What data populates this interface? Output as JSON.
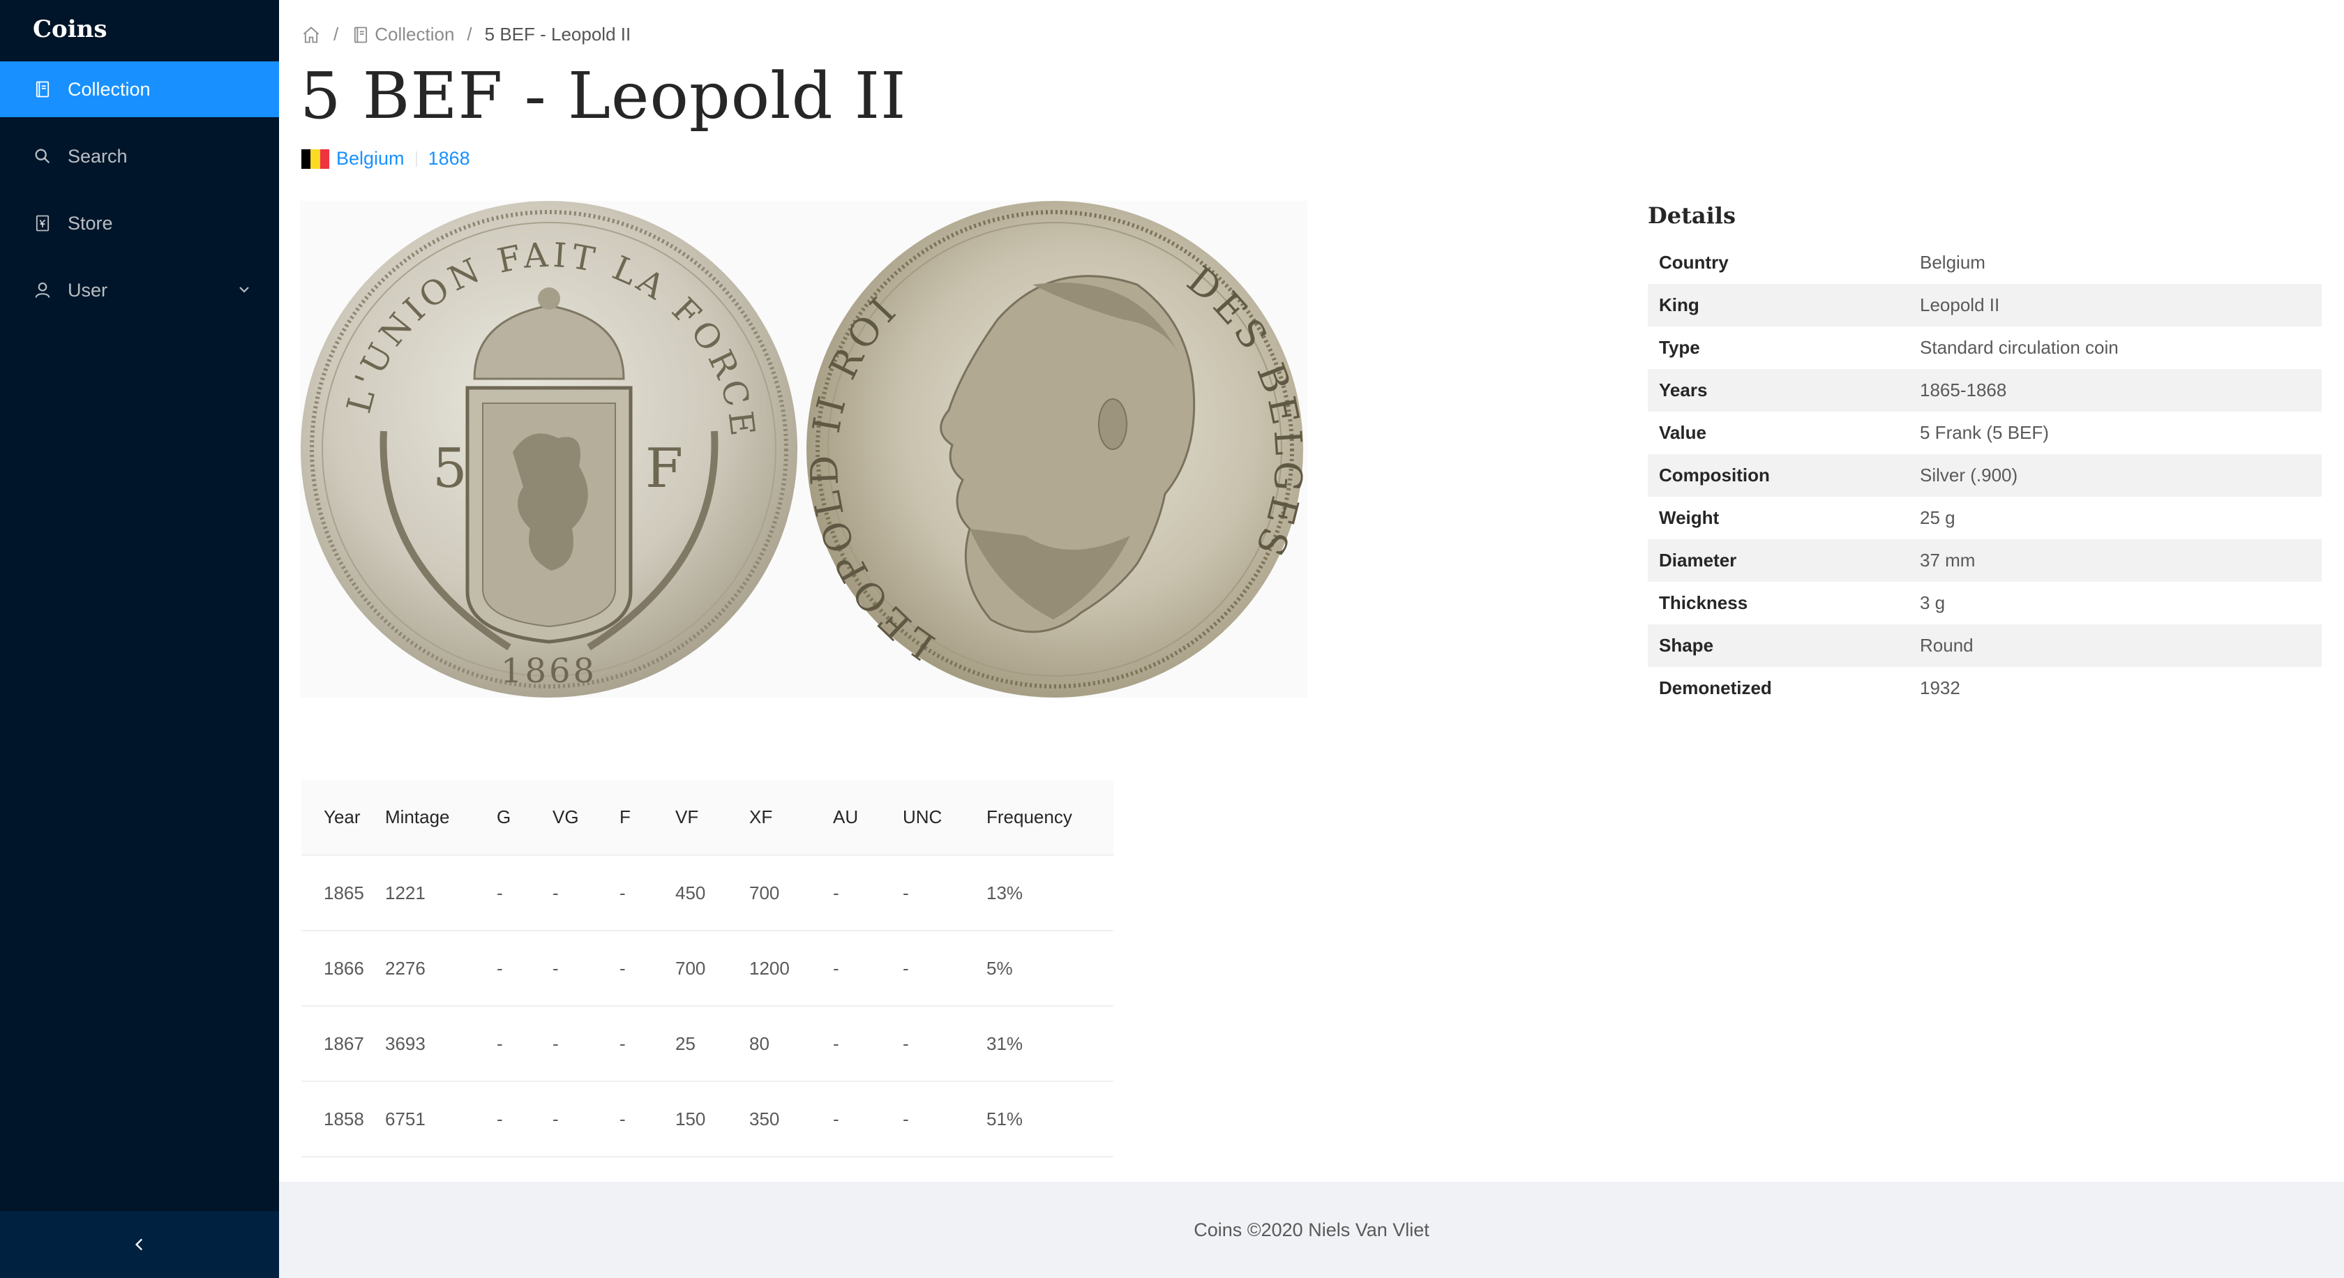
{
  "app": {
    "brand": "Coins"
  },
  "sidebar": {
    "items": [
      {
        "label": "Collection",
        "icon": "book-icon",
        "active": true
      },
      {
        "label": "Search",
        "icon": "search-icon",
        "active": false
      },
      {
        "label": "Store",
        "icon": "store-icon",
        "active": false
      },
      {
        "label": "User",
        "icon": "user-icon",
        "active": false,
        "has_submenu": true
      }
    ],
    "collapse_icon": "chevron-left-icon"
  },
  "breadcrumb": {
    "home_icon": "home-icon",
    "collection": "Collection",
    "current": "5 BEF - Leopold II"
  },
  "page": {
    "title": "5 BEF - Leopold II",
    "country": "Belgium",
    "year": "1868",
    "flag_colors": [
      "#000000",
      "#FDDA24",
      "#EF3340"
    ]
  },
  "coin_images": {
    "obverse": {
      "motto": "L'UNION FAIT LA FORCE",
      "value_left": "5",
      "value_right": "F",
      "date": "1868"
    },
    "reverse": {
      "legend_left": "LEOPOLD II ROI",
      "legend_right": "DES BELGES"
    }
  },
  "details": {
    "heading": "Details",
    "rows": [
      {
        "key": "Country",
        "value": "Belgium"
      },
      {
        "key": "King",
        "value": "Leopold II"
      },
      {
        "key": "Type",
        "value": "Standard circulation coin"
      },
      {
        "key": "Years",
        "value": "1865-1868"
      },
      {
        "key": "Value",
        "value": "5 Frank (5 BEF)"
      },
      {
        "key": "Composition",
        "value": "Silver (.900)"
      },
      {
        "key": "Weight",
        "value": "25 g"
      },
      {
        "key": "Diameter",
        "value": "37 mm"
      },
      {
        "key": "Thickness",
        "value": "3 g"
      },
      {
        "key": "Shape",
        "value": "Round"
      },
      {
        "key": "Demonetized",
        "value": "1932"
      }
    ]
  },
  "mintage": {
    "columns": [
      "Year",
      "Mintage",
      "G",
      "VG",
      "F",
      "VF",
      "XF",
      "AU",
      "UNC",
      "Frequency"
    ],
    "rows": [
      [
        "1865",
        "1221",
        "-",
        "-",
        "-",
        "450",
        "700",
        "-",
        "-",
        "13%"
      ],
      [
        "1866",
        "2276",
        "-",
        "-",
        "-",
        "700",
        "1200",
        "-",
        "-",
        "5%"
      ],
      [
        "1867",
        "3693",
        "-",
        "-",
        "-",
        "25",
        "80",
        "-",
        "-",
        "31%"
      ],
      [
        "1858",
        "6751",
        "-",
        "-",
        "-",
        "150",
        "350",
        "-",
        "-",
        "51%"
      ]
    ]
  },
  "footer": {
    "text": "Coins ©2020 Niels Van Vliet"
  },
  "colors": {
    "sidebar_bg": "#001529",
    "accent": "#1890ff",
    "footer_bg": "#f0f2f5"
  }
}
